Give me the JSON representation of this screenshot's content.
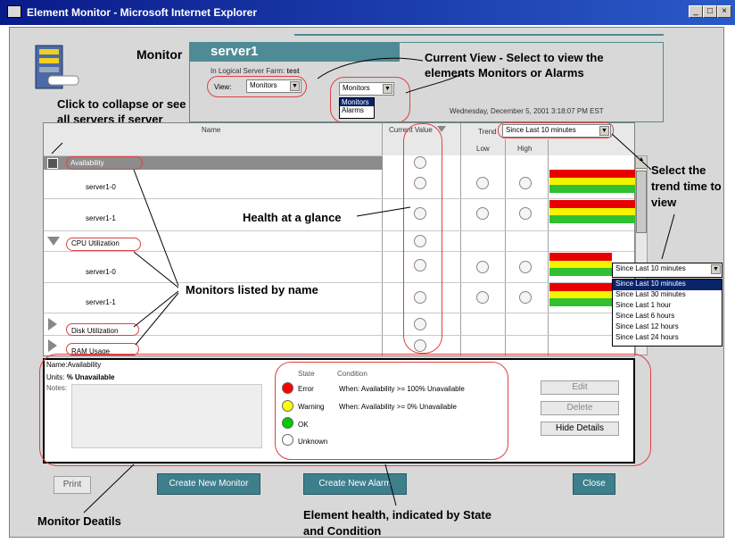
{
  "window": {
    "title": "Element Monitor - Microsoft Internet Explorer"
  },
  "header": {
    "monitor_label": "Monitor",
    "server_name": "server1",
    "farm_label": "In Logical Server Farm:",
    "farm_value": "test",
    "view_label": "View:",
    "view_value": "Monitors",
    "dropdown": {
      "selected": "Monitors",
      "options": [
        "Monitors",
        "Alarms"
      ]
    },
    "datetime": "Wednesday, December 5, 2001 3:18:07 PM EST"
  },
  "table": {
    "col_name": "Name",
    "col_current": "Current Value",
    "col_trend": "Trend",
    "trend_select": "Since Last 10 minutes",
    "col_low": "Low",
    "col_high": "High",
    "rows": [
      {
        "label": "Availability"
      },
      {
        "label": "server1-0"
      },
      {
        "label": "server1-1"
      },
      {
        "label": "CPU Utilization"
      },
      {
        "label": "server1-0"
      },
      {
        "label": "server1-1"
      },
      {
        "label": "Disk Utilization"
      },
      {
        "label": "RAM Usage"
      }
    ]
  },
  "trend_popup": {
    "selected": "Since Last 10 minutes",
    "options": [
      "Since Last 10 minutes",
      "Since Last 30 minutes",
      "Since Last 1 hour",
      "Since Last 6 hours",
      "Since Last 12 hours",
      "Since Last 24 hours"
    ]
  },
  "details": {
    "name_label": "Name:",
    "name_value": "Availability",
    "units_label": "Units:",
    "units_value": "% Unavailable",
    "notes_label": "Notes:",
    "state_header": "State",
    "condition_header": "Condition",
    "states": [
      {
        "label": "Error",
        "condition": "When: Availability >= 100% Unavailable",
        "color": "#ff0000"
      },
      {
        "label": "Warning",
        "condition": "When: Availability >= 0% Unavailable",
        "color": "#ffff00"
      },
      {
        "label": "OK",
        "condition": "",
        "color": "#00cc00"
      },
      {
        "label": "Unknown",
        "condition": "",
        "color": "#ffffff"
      }
    ],
    "edit_button": "Edit",
    "delete_button": "Delete",
    "hide_button": "Hide Details"
  },
  "buttons": {
    "print": "Print",
    "create_monitor": "Create New Monitor",
    "create_alarm": "Create New Alarm",
    "close": "Close"
  },
  "callouts": {
    "current_view": "Current View - Select to view the elements Monitors or Alarms",
    "collapse": "Click to collapse or see all servers if server group",
    "select_trend": "Select the trend time to view",
    "health": "Health at a glance",
    "monitors_listed": "Monitors listed by name",
    "monitor_details": "Monitor Deatils",
    "element_health": "Element health, indicated by State and Condition"
  }
}
